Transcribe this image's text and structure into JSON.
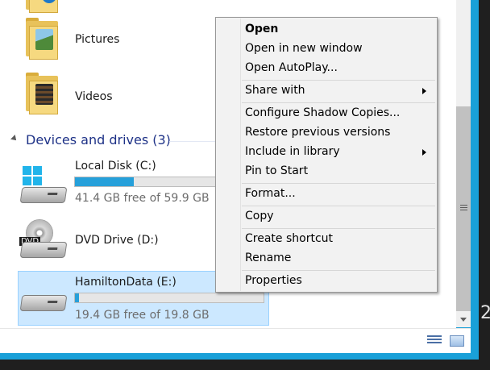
{
  "folders": [
    {
      "name": "Pictures"
    },
    {
      "name": "Videos"
    }
  ],
  "section": {
    "title": "Devices and drives (3)"
  },
  "drives": [
    {
      "name": "Local Disk (C:)",
      "free_text": "41.4 GB free of 59.9 GB",
      "used_fraction": 0.31
    },
    {
      "name": "DVD Drive (D:)",
      "dvd_label": "DVD"
    },
    {
      "name": "HamiltonData (E:)",
      "free_text": "19.4 GB free of 19.8 GB",
      "used_fraction": 0.02
    }
  ],
  "context_menu": {
    "items": [
      {
        "label": "Open",
        "bold": true
      },
      {
        "label": "Open in new window"
      },
      {
        "label": "Open AutoPlay..."
      },
      {
        "label": "Share with",
        "submenu": true
      },
      {
        "label": "Configure Shadow Copies..."
      },
      {
        "label": "Restore previous versions"
      },
      {
        "label": "Include in library",
        "submenu": true
      },
      {
        "label": "Pin to Start"
      },
      {
        "label": "Format..."
      },
      {
        "label": "Copy"
      },
      {
        "label": "Create shortcut"
      },
      {
        "label": "Rename"
      },
      {
        "label": "Properties"
      }
    ]
  },
  "edge_text": "2",
  "colors": {
    "accent": "#19a0d8",
    "bar_fill": "#26a0da",
    "selection": "#cce8ff",
    "section_title": "#1e3287"
  },
  "icons": [
    "folder-icon",
    "pictures-folder-icon",
    "videos-folder-icon",
    "local-disk-icon",
    "dvd-drive-icon",
    "removable-drive-icon",
    "details-view-icon",
    "tiles-view-icon",
    "submenu-arrow-icon"
  ]
}
